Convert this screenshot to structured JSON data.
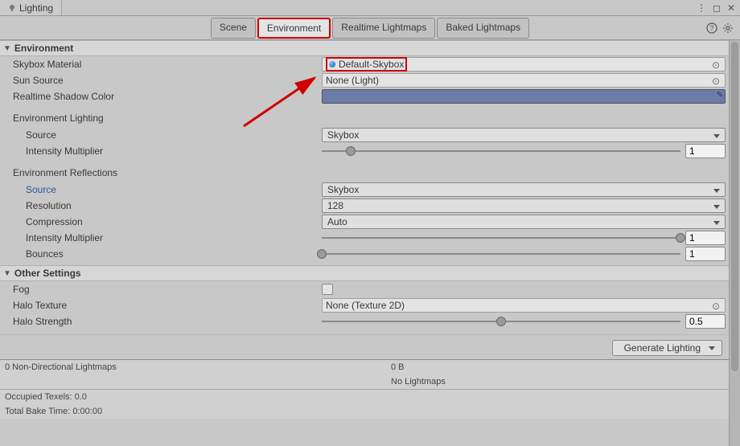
{
  "window": {
    "title": "Lighting",
    "help_icon": "?",
    "menu_icon": "⋮",
    "lock_icon": "🔒"
  },
  "tabs": {
    "scene": "Scene",
    "environment": "Environment",
    "realtime": "Realtime Lightmaps",
    "baked": "Baked Lightmaps"
  },
  "sections": {
    "environment": "Environment",
    "other_settings": "Other Settings"
  },
  "env": {
    "skybox_material_label": "Skybox Material",
    "skybox_material_value": "Default-Skybox",
    "sun_source_label": "Sun Source",
    "sun_source_value": "None (Light)",
    "realtime_shadow_label": "Realtime Shadow Color",
    "realtime_shadow_color": "#6d7ba8",
    "lighting_heading": "Environment Lighting",
    "lighting_source_label": "Source",
    "lighting_source_value": "Skybox",
    "lighting_intensity_label": "Intensity Multiplier",
    "lighting_intensity_value": "1",
    "reflections_heading": "Environment Reflections",
    "reflections_source_label": "Source",
    "reflections_source_value": "Skybox",
    "resolution_label": "Resolution",
    "resolution_value": "128",
    "compression_label": "Compression",
    "compression_value": "Auto",
    "reflections_intensity_label": "Intensity Multiplier",
    "reflections_intensity_value": "1",
    "bounces_label": "Bounces",
    "bounces_value": "1"
  },
  "other": {
    "fog_label": "Fog",
    "halo_texture_label": "Halo Texture",
    "halo_texture_value": "None (Texture 2D)",
    "halo_strength_label": "Halo Strength",
    "halo_strength_value": "0.5"
  },
  "generate": {
    "button_label": "Generate Lighting"
  },
  "status": {
    "lightmaps_count": "0 Non-Directional Lightmaps",
    "lightmaps_size": "0 B",
    "no_lightmaps": "No Lightmaps",
    "occupied_texels": "Occupied Texels: 0.0",
    "bake_time": "Total Bake Time: 0:00:00"
  }
}
